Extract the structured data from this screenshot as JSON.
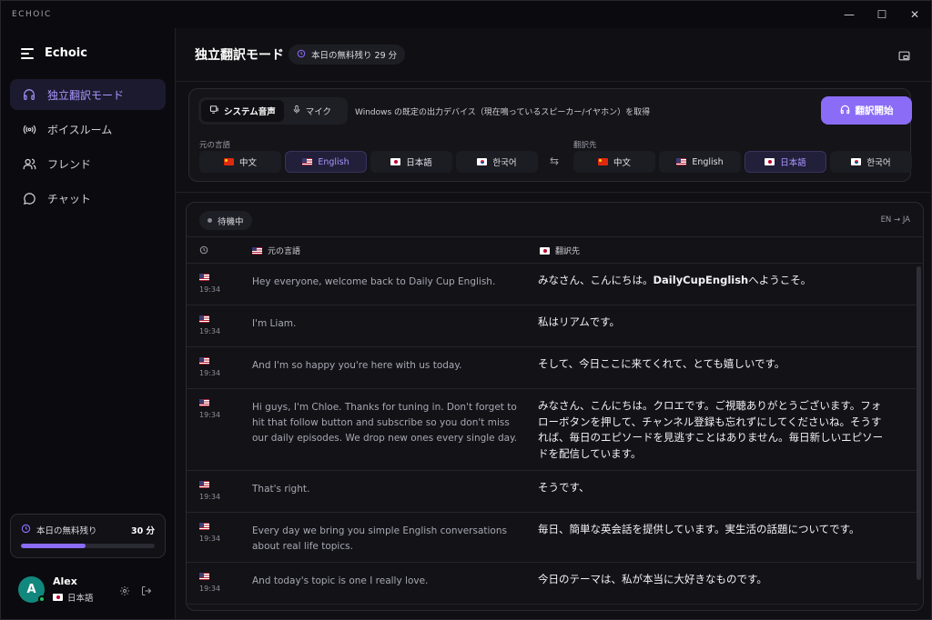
{
  "titlebar": {
    "app_name": "ECHOIC",
    "minimize": "—",
    "maximize": "☐",
    "close": "✕"
  },
  "sidebar": {
    "brand": "Echoic",
    "items": [
      {
        "label": "独立翻訳モード",
        "icon": "headphones-icon",
        "active": true
      },
      {
        "label": "ボイスルーム",
        "icon": "broadcast-icon",
        "active": false
      },
      {
        "label": "フレンド",
        "icon": "users-icon",
        "active": false
      },
      {
        "label": "チャット",
        "icon": "chat-bubble-icon",
        "active": false
      }
    ],
    "quota": {
      "label": "本日の無料残り",
      "value": "30 分",
      "progress": 0.48
    },
    "user": {
      "initial": "A",
      "name": "Alex",
      "language": "日本語"
    }
  },
  "header": {
    "title": "独立翻訳モード",
    "badge": "本日の無料残り 29 分"
  },
  "controls": {
    "source_tabs": [
      "システム音声",
      "マイク"
    ],
    "device_text": "Windows の既定の出力デバイス（現在鳴っているスピーカー/イヤホン）を取得",
    "start_button": "翻訳開始",
    "source_label": "元の言語",
    "target_label": "翻訳先",
    "source_langs": [
      {
        "flag": "cn",
        "label": "中文",
        "active": false
      },
      {
        "flag": "us",
        "label": "English",
        "active": true
      },
      {
        "flag": "jp",
        "label": "日本語",
        "active": false
      },
      {
        "flag": "kr",
        "label": "한국어",
        "active": false
      }
    ],
    "target_langs": [
      {
        "flag": "cn",
        "label": "中文",
        "active": false
      },
      {
        "flag": "us",
        "label": "English",
        "active": false
      },
      {
        "flag": "jp",
        "label": "日本語",
        "active": true
      },
      {
        "flag": "kr",
        "label": "한국어",
        "active": false
      }
    ],
    "swap": "⇆"
  },
  "transcript": {
    "status": "待機中",
    "direction": "EN → JA",
    "col_source": "元の言語",
    "col_target": "翻訳先",
    "rows": [
      {
        "time": "19:34",
        "src": "Hey everyone, welcome back to Daily Cup English.",
        "dst_pre": "みなさん、こんにちは。",
        "dst_bold": "DailyCupEnglish",
        "dst_post": "へようこそ。",
        "h": 46
      },
      {
        "time": "19:34",
        "src": "I'm Liam.",
        "dst_pre": "私はリアムです。",
        "dst_bold": "",
        "dst_post": "",
        "h": 46
      },
      {
        "time": "19:34",
        "src": "And I'm so happy you're here with us today.",
        "dst_pre": "そして、今日ここに来てくれて、とても嬉しいです。",
        "dst_bold": "",
        "dst_post": "",
        "h": 46
      },
      {
        "time": "19:34",
        "src": "Hi guys, I'm Chloe. Thanks for tuning in. Don't forget to hit that follow button and subscribe so you don't miss our daily episodes. We drop new ones every single day.",
        "dst_pre": "みなさん、こんにちは。クロエです。ご視聴ありがとうございます。フォローボタンを押して、チャンネル登録も忘れずにしてくださいね。そうすれば、毎日のエピソードを見逃すことはありません。毎日新しいエピソードを配信しています。",
        "dst_bold": "",
        "dst_post": "",
        "h": 90
      },
      {
        "time": "19:34",
        "src": "That's right.",
        "dst_pre": "そうです、",
        "dst_bold": "",
        "dst_post": "",
        "h": 46
      },
      {
        "time": "19:34",
        "src": "Every day we bring you simple English conversations about real life topics.",
        "dst_pre": "毎日、簡単な英会話を提供しています。実生活の話題についてです。",
        "dst_bold": "",
        "dst_post": "",
        "h": 55
      },
      {
        "time": "19:34",
        "src": "And today's topic is one I really love.",
        "dst_pre": "今日のテーマは、私が本当に大好きなものです。",
        "dst_bold": "",
        "dst_post": "",
        "h": 46
      }
    ]
  }
}
